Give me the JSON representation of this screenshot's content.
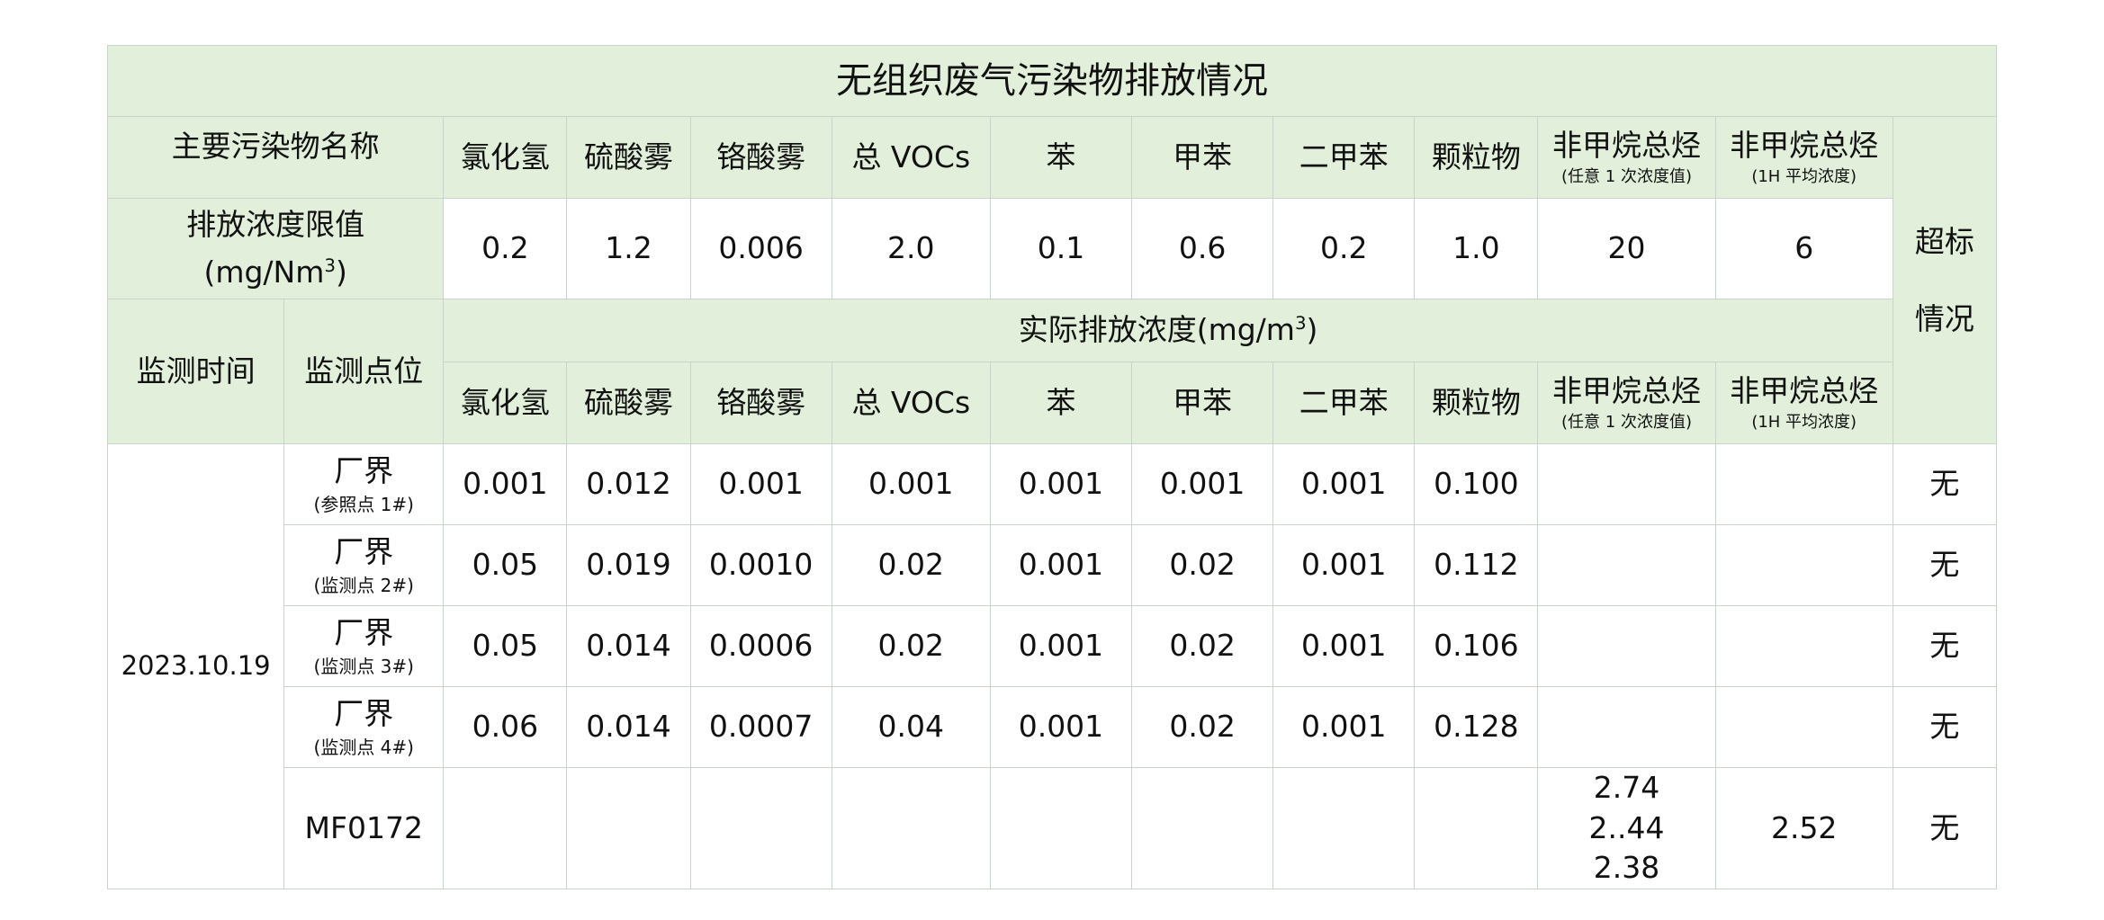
{
  "title": "无组织废气污染物排放情况",
  "labels": {
    "main_pollutant_name": "主要污染物名称",
    "limit_label": "排放浓度限值",
    "limit_unit": "(mg/Nm",
    "limit_unit_sup": "3",
    "limit_unit_close": ")",
    "exceed_line1": "超标",
    "exceed_line2": "情况",
    "monitor_time": "监测时间",
    "monitor_point": "监测点位",
    "actual_conc": "实际排放浓度(mg/m",
    "actual_conc_sup": "3",
    "actual_conc_close": ")"
  },
  "pollutants": [
    {
      "name": "氯化氢",
      "note": ""
    },
    {
      "name": "硫酸雾",
      "note": ""
    },
    {
      "name": "铬酸雾",
      "note": ""
    },
    {
      "name": "总 VOCs",
      "note": ""
    },
    {
      "name": "苯",
      "note": ""
    },
    {
      "name": "甲苯",
      "note": ""
    },
    {
      "name": "二甲苯",
      "note": ""
    },
    {
      "name": "颗粒物",
      "note": ""
    },
    {
      "name": "非甲烷总烃",
      "note": "(任意 1 次浓度值)"
    },
    {
      "name": "非甲烷总烃",
      "note": "(1H 平均浓度)"
    }
  ],
  "limits": [
    "0.2",
    "1.2",
    "0.006",
    "2.0",
    "0.1",
    "0.6",
    "0.2",
    "1.0",
    "20",
    "6"
  ],
  "date": "2023.10.19",
  "rows": [
    {
      "site": "厂界",
      "note": "(参照点 1#)",
      "values": [
        "0.001",
        "0.012",
        "0.001",
        "0.001",
        "0.001",
        "0.001",
        "0.001",
        "0.100",
        "",
        ""
      ],
      "exceed": "无"
    },
    {
      "site": "厂界",
      "note": "(监测点 2#)",
      "values": [
        "0.05",
        "0.019",
        "0.0010",
        "0.02",
        "0.001",
        "0.02",
        "0.001",
        "0.112",
        "",
        ""
      ],
      "exceed": "无"
    },
    {
      "site": "厂界",
      "note": "(监测点 3#)",
      "values": [
        "0.05",
        "0.014",
        "0.0006",
        "0.02",
        "0.001",
        "0.02",
        "0.001",
        "0.106",
        "",
        ""
      ],
      "exceed": "无"
    },
    {
      "site": "厂界",
      "note": "(监测点 4#)",
      "values": [
        "0.06",
        "0.014",
        "0.0007",
        "0.04",
        "0.001",
        "0.02",
        "0.001",
        "0.128",
        "",
        ""
      ],
      "exceed": "无"
    }
  ],
  "mf_row": {
    "site": "MF0172",
    "nmhc_any": [
      "2.74",
      "2..44",
      "2.38"
    ],
    "nmhc_avg": "2.52",
    "exceed": "无"
  }
}
